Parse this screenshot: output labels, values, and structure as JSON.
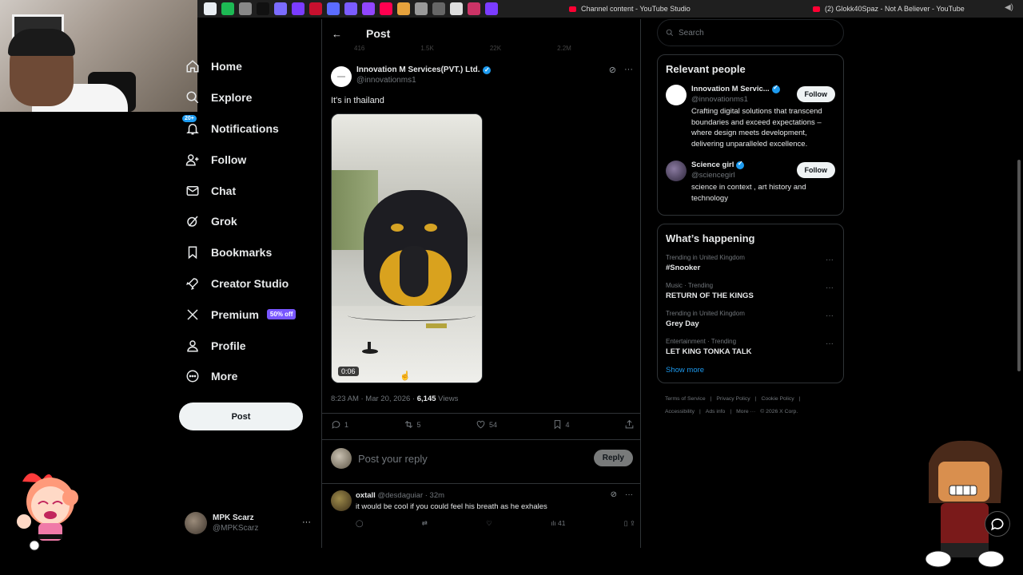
{
  "browser": {
    "tabs": [
      {
        "title": "Channel content - YouTube Studio"
      },
      {
        "title": "(2) Glokk40Spaz - Not A Believer - YouTube"
      }
    ],
    "ext_colors": [
      "#e9eef3",
      "#1db954",
      "#888",
      "#111",
      "#7b6cff",
      "#7a3cff",
      "#c8102e",
      "#5b6cff",
      "#7b5cff",
      "#9146ff",
      "#ff0050",
      "#e6a23c",
      "#999",
      "#666",
      "#ddd",
      "#cc3366",
      "#7b3cff"
    ]
  },
  "nav": {
    "items": [
      {
        "label": "Home",
        "icon": "home-icon"
      },
      {
        "label": "Explore",
        "icon": "search-icon"
      },
      {
        "label": "Notifications",
        "icon": "bell-icon",
        "badge": "20+"
      },
      {
        "label": "Follow",
        "icon": "add-user-icon"
      },
      {
        "label": "Chat",
        "icon": "mail-icon"
      },
      {
        "label": "Grok",
        "icon": "grok-icon"
      },
      {
        "label": "Bookmarks",
        "icon": "bookmark-icon"
      },
      {
        "label": "Creator Studio",
        "icon": "rocket-icon"
      },
      {
        "label": "Premium",
        "icon": "x-logo-icon",
        "badge": "50% off"
      },
      {
        "label": "Profile",
        "icon": "person-icon"
      },
      {
        "label": "More",
        "icon": "more-circle-icon"
      }
    ],
    "post_button": "Post"
  },
  "account": {
    "name": "MPK Scarz",
    "handle": "@MPKScarz",
    "more": "···"
  },
  "main": {
    "header_title": "Post",
    "ghost_counts": [
      "416",
      "1.5K",
      "22K",
      "2.2M"
    ],
    "post": {
      "author": "Innovation M Services(PVT.) Ltd.",
      "handle": "@innovationms1",
      "text": "It's in thailand",
      "video_duration": "0:06",
      "timestamp": "8:23 AM · Mar 20, 2026 · ",
      "views_count": "6,145",
      "views_label": " Views",
      "stats": {
        "replies": "1",
        "reposts": "5",
        "likes": "54",
        "bookmarks": "4"
      }
    },
    "reply": {
      "placeholder": "Post your reply",
      "button": "Reply"
    },
    "comment": {
      "author": "oxtall",
      "handle_time": " @desdaguiar · 32m",
      "text": "it would be cool if you could feel his breath as he exhales",
      "views": "41"
    }
  },
  "right": {
    "search_placeholder": "Search",
    "relevant": {
      "title": "Relevant people",
      "people": [
        {
          "name": "Innovation M Servic...",
          "handle": "@innovationms1",
          "bio": "Crafting digital solutions that transcend boundaries and exceed expectations – where design meets development, delivering unparalleled excellence.",
          "button": "Follow"
        },
        {
          "name": "Science girl",
          "handle": "@sciencegirl",
          "bio": "science in context , art history and technology",
          "button": "Follow"
        }
      ]
    },
    "happening": {
      "title": "What’s happening",
      "trends": [
        {
          "category": "Trending in United Kingdom",
          "name": "#Snooker"
        },
        {
          "category": "Music · Trending",
          "name": "RETURN OF THE KINGS"
        },
        {
          "category": "Trending in United Kingdom",
          "name": "Grey Day"
        },
        {
          "category": "Entertainment · Trending",
          "name": "LET KING TONKA TALK"
        }
      ],
      "show_more": "Show more"
    },
    "footer": [
      "Terms of Service",
      "|",
      "Privacy Policy",
      "|",
      "Cookie Policy",
      "|",
      "Accessibility",
      "|",
      "Ads info",
      "|",
      "More ···",
      "© 2026 X Corp."
    ]
  }
}
